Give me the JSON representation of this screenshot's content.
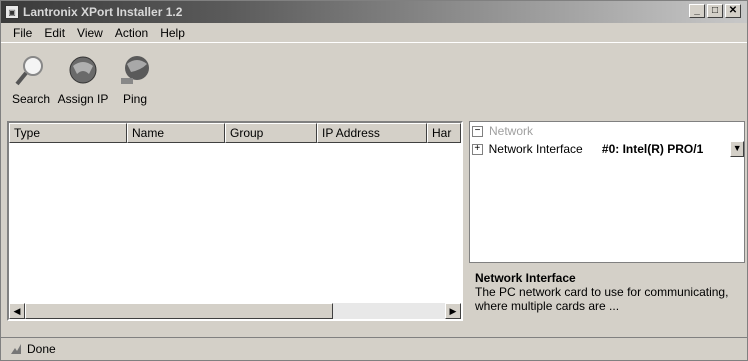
{
  "window": {
    "title": "Lantronix XPort Installer 1.2",
    "controls": {
      "minimize": "_",
      "restore": "□",
      "close": "✕"
    }
  },
  "menu": [
    {
      "label": "File",
      "key": "F"
    },
    {
      "label": "Edit",
      "key": "E"
    },
    {
      "label": "View",
      "key": "V"
    },
    {
      "label": "Action",
      "key": "A"
    },
    {
      "label": "Help",
      "key": "H"
    }
  ],
  "toolbar": {
    "search_label": "Search",
    "assign_ip_label": "Assign IP",
    "ping_label": "Ping"
  },
  "device_list": {
    "columns": [
      "Type",
      "Name",
      "Group",
      "IP Address",
      "Har"
    ],
    "rows": []
  },
  "properties": {
    "category": "Network",
    "items": [
      {
        "name": "Network Interface",
        "value": "#0: Intel(R) PRO/1"
      }
    ]
  },
  "description": {
    "title": "Network Interface",
    "text": "The PC network card to use for communicating, where multiple cards are ..."
  },
  "status": {
    "text": "Done"
  }
}
